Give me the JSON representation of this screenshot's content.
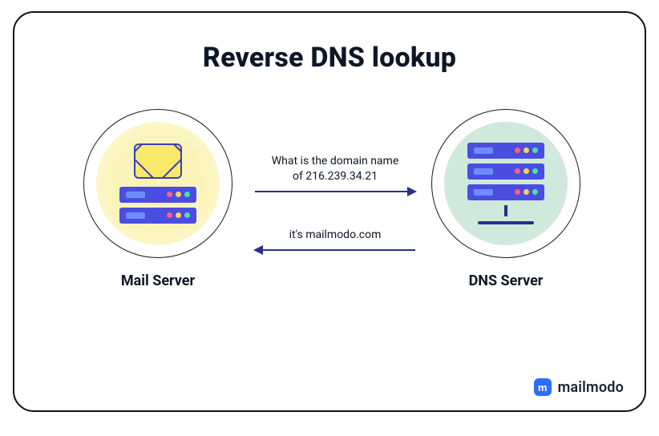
{
  "title": "Reverse DNS lookup",
  "left_node": {
    "label": "Mail Server",
    "icon_top": "envelope-icon",
    "icon_stack": "server-rack-icon",
    "halo_color": "#faf3b8"
  },
  "right_node": {
    "label": "DNS Server",
    "icon": "server-rack-icon",
    "halo_color": "#cfe9dc"
  },
  "arrows": {
    "request": {
      "direction": "right",
      "label_line1": "What is the domain name",
      "label_line2": "of 216.239.34.21"
    },
    "response": {
      "direction": "left",
      "label": "it's mailmodo.com"
    }
  },
  "brand": {
    "mark_letter": "m",
    "name": "mailmodo"
  },
  "colors": {
    "arrow": "#2a2e8f",
    "server_bar": "#4a4de0",
    "text": "#0e1726"
  }
}
